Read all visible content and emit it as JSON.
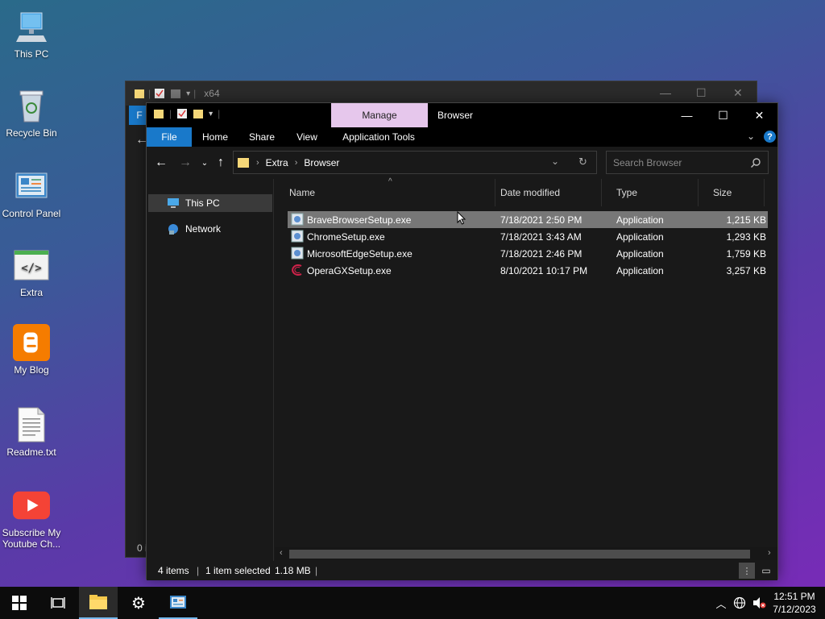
{
  "desktop": {
    "icons": [
      {
        "label": "This PC"
      },
      {
        "label": "Recycle Bin"
      },
      {
        "label": "Control Panel"
      },
      {
        "label": "Extra"
      },
      {
        "label": "My Blog"
      },
      {
        "label": "Readme.txt"
      },
      {
        "label": "Subscribe My Youtube Ch..."
      }
    ]
  },
  "bg_window": {
    "title": "x64",
    "file_tab": "F",
    "status": "0 i"
  },
  "window": {
    "title": "Browser",
    "context_tab": "Manage",
    "ribbon_tabs": [
      "File",
      "Home",
      "Share",
      "View",
      "Application Tools"
    ],
    "breadcrumb": [
      "Extra",
      "Browser"
    ],
    "search_placeholder": "Search Browser",
    "nav": [
      {
        "label": "This PC"
      },
      {
        "label": "Network"
      }
    ],
    "columns": [
      "Name",
      "Date modified",
      "Type",
      "Size"
    ],
    "files": [
      {
        "name": "BraveBrowserSetup.exe",
        "date": "7/18/2021 2:50 PM",
        "type": "Application",
        "size": "1,215 KB"
      },
      {
        "name": "ChromeSetup.exe",
        "date": "7/18/2021 3:43 AM",
        "type": "Application",
        "size": "1,293 KB"
      },
      {
        "name": "MicrosoftEdgeSetup.exe",
        "date": "7/18/2021 2:46 PM",
        "type": "Application",
        "size": "1,759 KB"
      },
      {
        "name": "OperaGXSetup.exe",
        "date": "8/10/2021 10:17 PM",
        "type": "Application",
        "size": "3,257 KB"
      }
    ],
    "status": {
      "items": "4 items",
      "selected": "1 item selected",
      "size": "1.18 MB"
    }
  },
  "taskbar": {
    "time": "12:51 PM",
    "date": "7/12/2023"
  },
  "colors": {
    "file_tab": "#1979ca",
    "manage_tab": "#e6c7ec",
    "selected_row": "#777777"
  }
}
